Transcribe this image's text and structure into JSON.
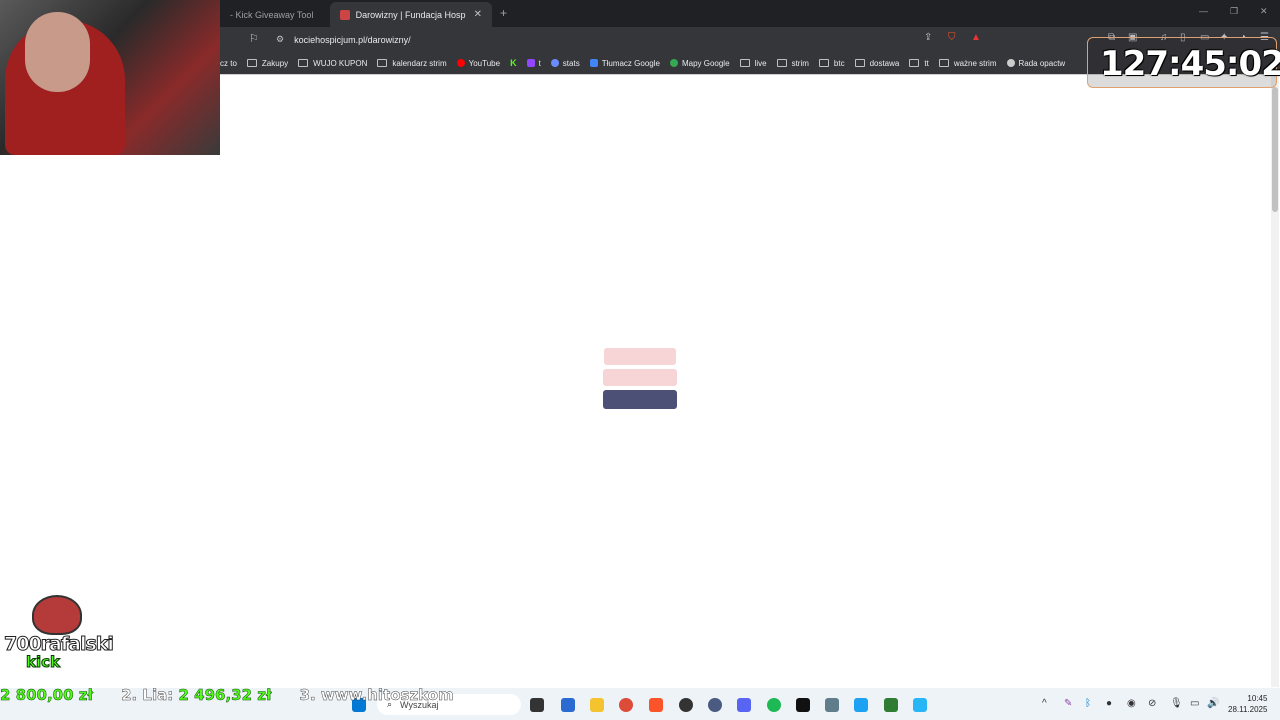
{
  "browser": {
    "tabs": [
      {
        "label": "- Kick Giveaway Tool",
        "active": false
      },
      {
        "label": "Darowizny | Fundacja Hospicjum",
        "active": true
      }
    ],
    "url": "kociehospicjum.pl/darowizny/",
    "bookmarks": [
      "cz to",
      "Zakupy",
      "WUJO KUPON",
      "kalendarz strim",
      "YouTube",
      "t",
      "stats",
      "Tłumacz Google",
      "Mapy Google",
      "live",
      "strim",
      "btc",
      "dostawa",
      "tt",
      "ważne strim",
      "Rada opactw"
    ]
  },
  "overlay": {
    "timer": "127:45:02",
    "channel": "700rafalski",
    "platform": "kick",
    "ticker": {
      "item1_amount": "2 800,00 zł",
      "item2_label": "2. Lia:",
      "item2_amount": "2 496,32 zł",
      "item3_label": "3. www.hitoszkom"
    }
  },
  "taskbar": {
    "search_placeholder": "Wyszukaj",
    "time": "10:45",
    "date": "28.11.2025"
  },
  "colors": {
    "loader_light": "#f7d5d7",
    "loader_dark": "#4c4f76",
    "kick_green": "#53fc18"
  }
}
